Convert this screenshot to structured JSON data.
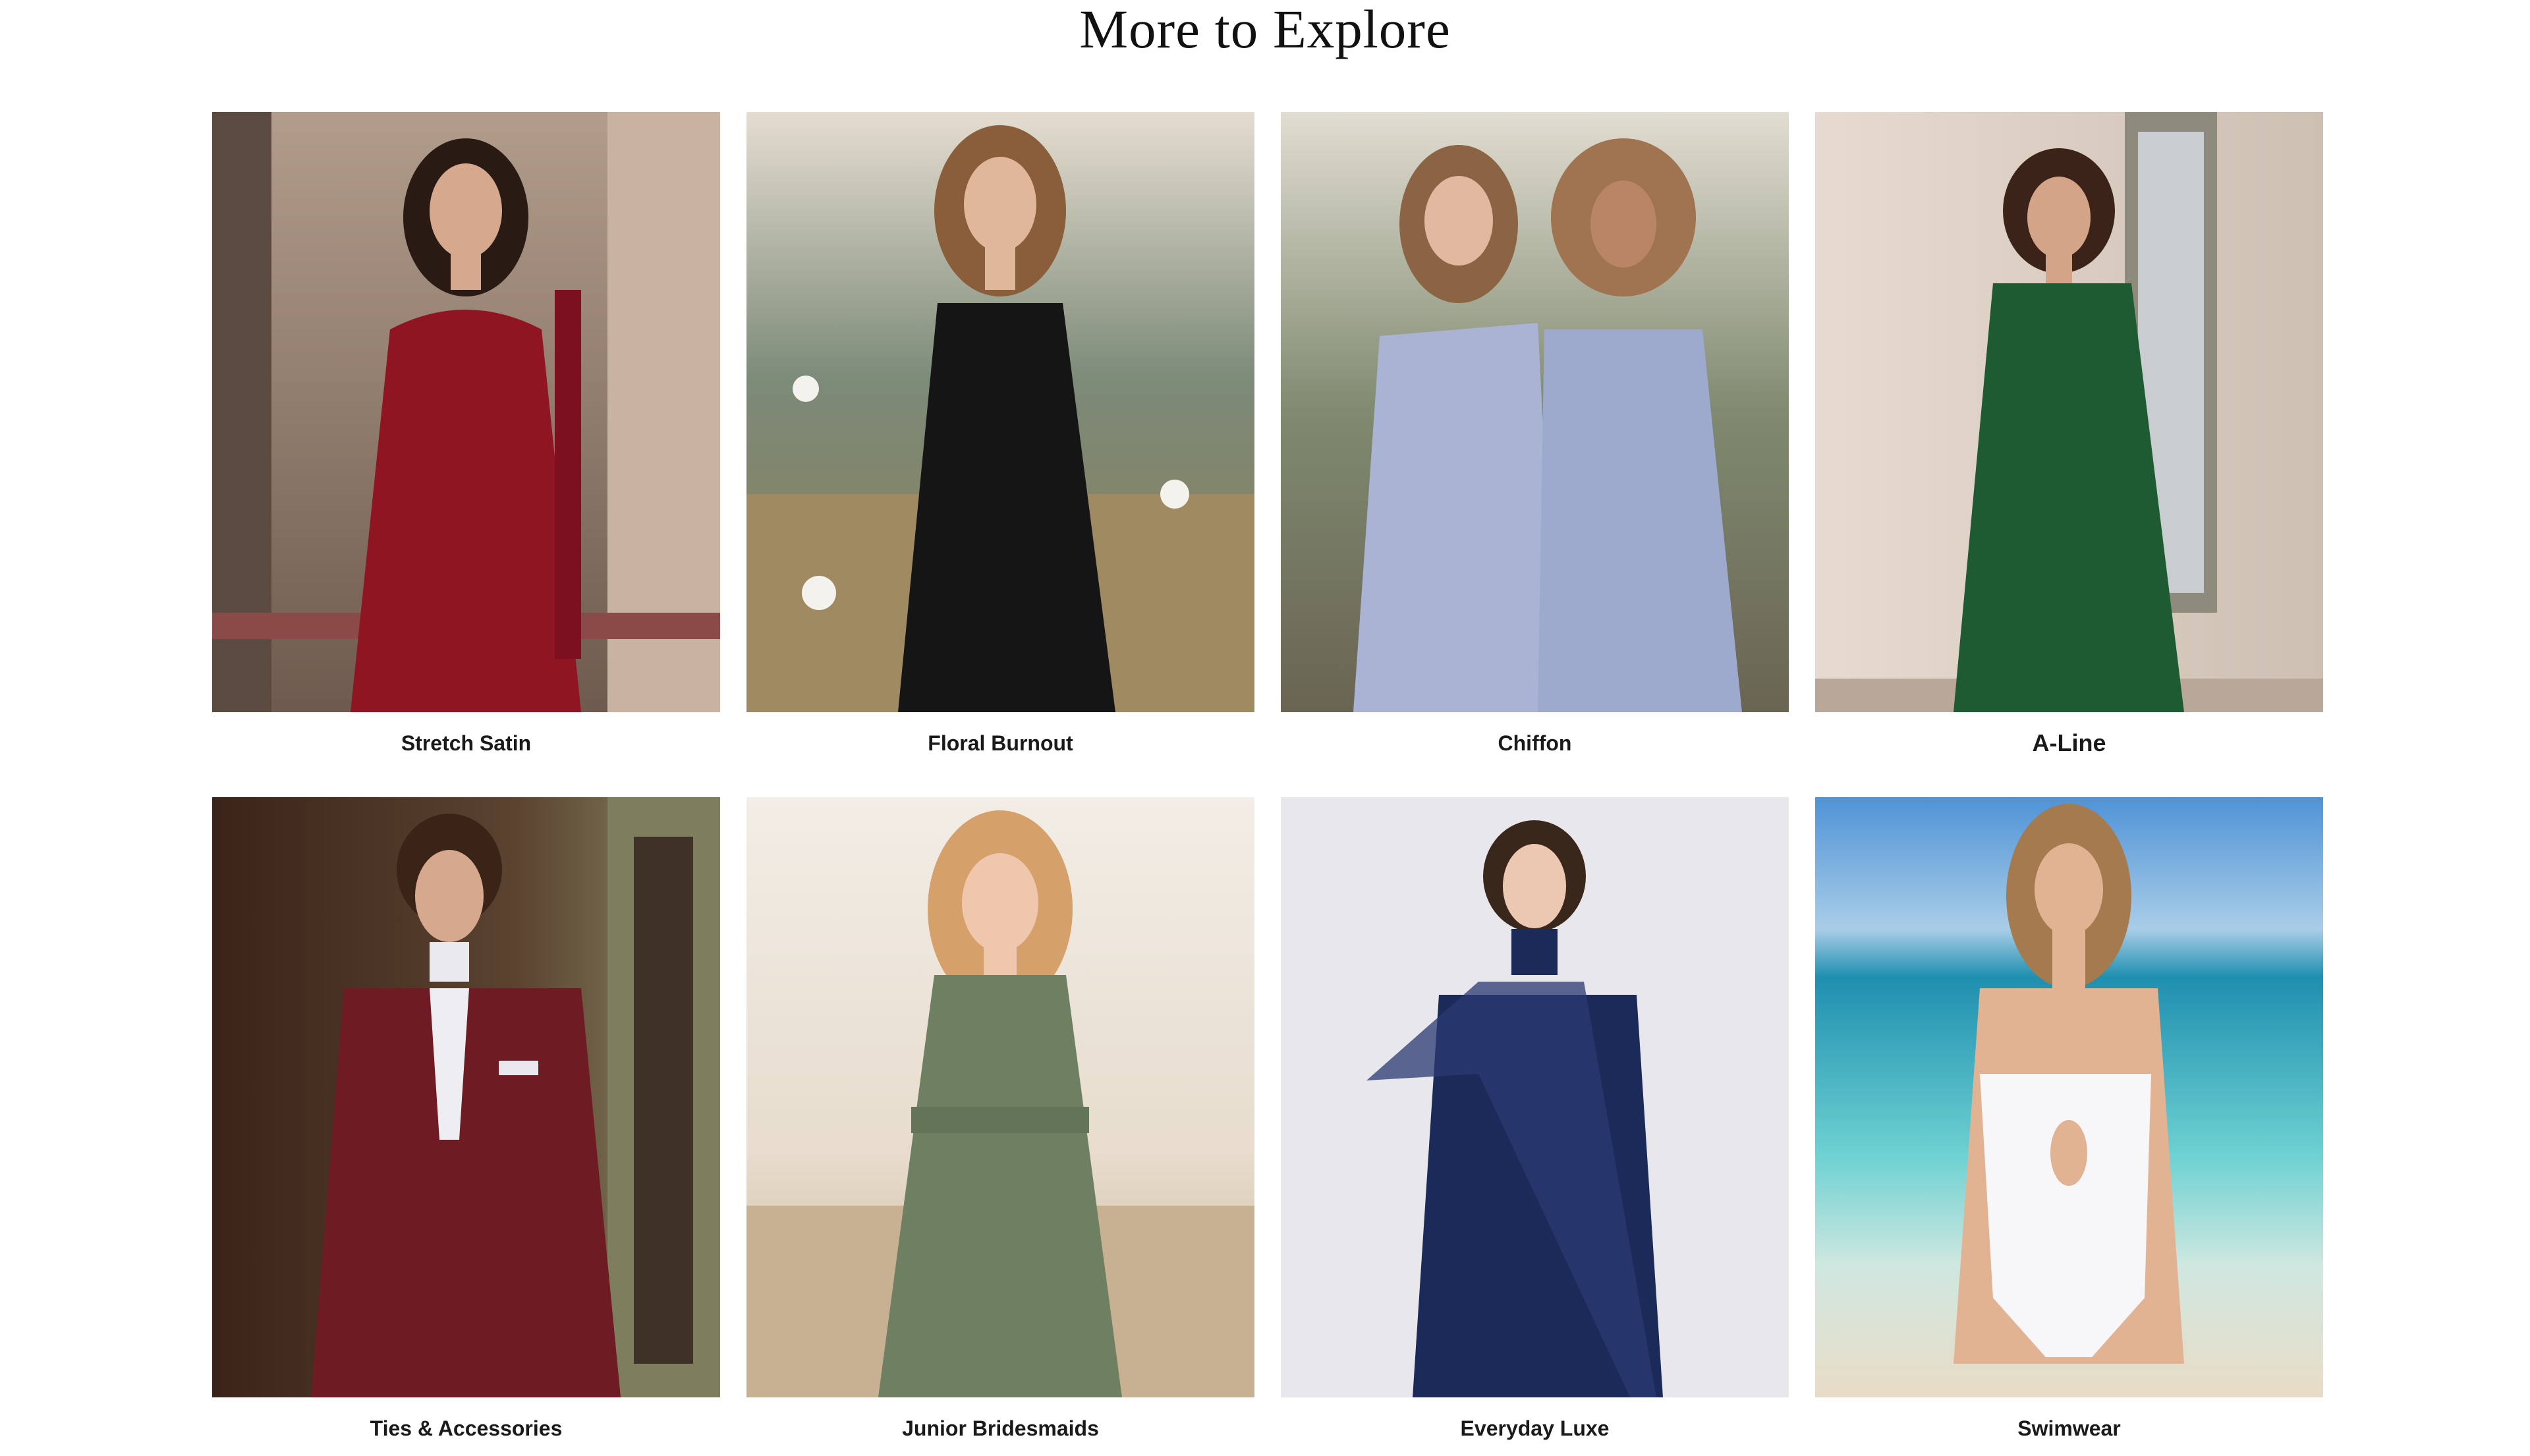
{
  "section": {
    "title": "More to Explore"
  },
  "categories": [
    {
      "label": "Stretch Satin",
      "dress_color": "#8f1523",
      "bg_top": "#b29d8c",
      "bg_bottom": "#6e5a4e"
    },
    {
      "label": "Floral Burnout",
      "dress_color": "#151515",
      "bg_top": "#d9d2c4",
      "bg_bottom": "#7d8a5a"
    },
    {
      "label": "Chiffon",
      "dress_color": "#a9b3d3",
      "bg_top": "#dcd8cf",
      "bg_bottom": "#6f7a55"
    },
    {
      "label": "A-Line",
      "dress_color": "#1e5b33",
      "bg_top": "#e6d9cf",
      "bg_bottom": "#cdbcae"
    },
    {
      "label": "Ties & Accessories",
      "dress_color": "#6e1b24",
      "bg_top": "#4a3326",
      "bg_bottom": "#8a8a68"
    },
    {
      "label": "Junior Bridesmaids",
      "dress_color": "#6f7f62",
      "bg_top": "#f1ece6",
      "bg_bottom": "#c8b193"
    },
    {
      "label": "Everyday Luxe",
      "dress_color": "#1c2a5a",
      "bg_top": "#ebebee",
      "bg_bottom": "#d9d9de"
    },
    {
      "label": "Swimwear",
      "dress_color": "#f7f7fa",
      "bg_top": "#4f93d6",
      "bg_bottom": "#e9dcc6"
    }
  ]
}
